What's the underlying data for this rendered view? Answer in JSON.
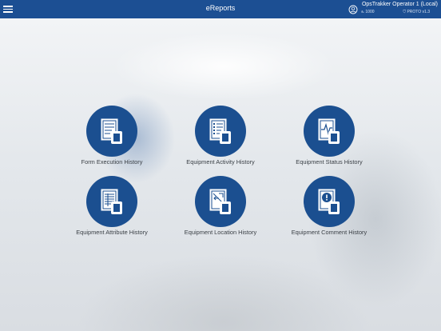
{
  "header": {
    "title": "eReports",
    "user_name": "OpsTrakker Operator 1 (Local)",
    "user_id": "1000",
    "version": "PROTO v1.3",
    "menu_icon": "hamburger-menu-icon",
    "user_icon": "user-circle-icon"
  },
  "colors": {
    "header_bg": "#1c4f93",
    "tile_bg": "#1b4f90"
  },
  "reports": [
    {
      "label": "Form Execution History",
      "icon": "form-execution-icon"
    },
    {
      "label": "Equipment Activity History",
      "icon": "equipment-activity-icon"
    },
    {
      "label": "Equipment Status History",
      "icon": "equipment-status-icon"
    },
    {
      "label": "Equipment Attribute History",
      "icon": "equipment-attribute-icon"
    },
    {
      "label": "Equipment Location History",
      "icon": "equipment-location-icon"
    },
    {
      "label": "Equipment Comment History",
      "icon": "equipment-comment-icon"
    }
  ]
}
